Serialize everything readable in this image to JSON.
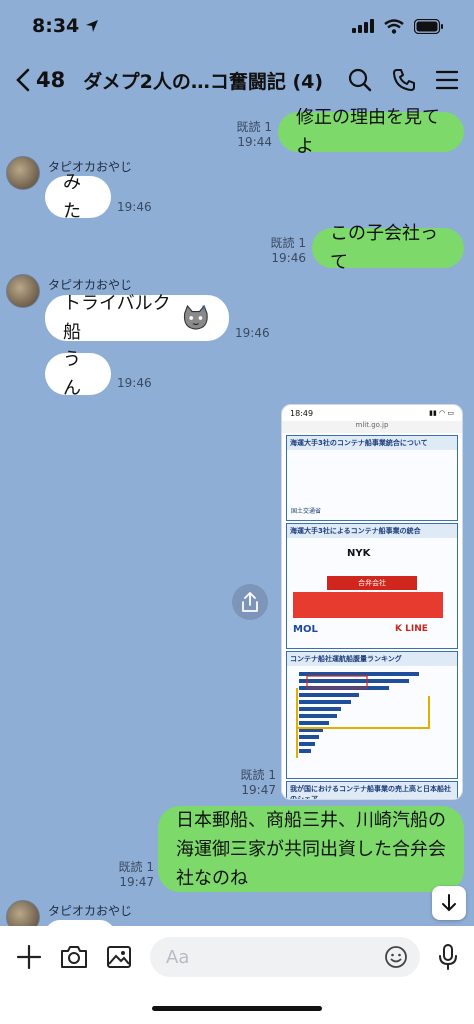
{
  "status": {
    "time": "8:34"
  },
  "header": {
    "back_count": "48",
    "title": "ダメプ2人の…コ奮闘記 (4)"
  },
  "messages": {
    "m1": {
      "text": "修正の理由を見てよ",
      "read": "既読 1",
      "time": "19:44"
    },
    "m2": {
      "sender": "タピオカおやじ",
      "text": "みた",
      "time": "19:46"
    },
    "m3": {
      "text": "この子会社って",
      "read": "既読 1",
      "time": "19:46"
    },
    "m4": {
      "sender": "タピオカおやじ",
      "text": "トライバルク船",
      "time": "19:46"
    },
    "m5": {
      "text": "うん",
      "time": "19:46"
    },
    "m6": {
      "read": "既読 1",
      "time": "19:47"
    },
    "m7": {
      "text": "日本郵船、商船三井、川崎汽船の海運御三家が共同出資した合弁会社なのね",
      "read": "既読 1",
      "time": "19:47"
    },
    "m8": {
      "sender": "タピオカおやじ"
    }
  },
  "image": {
    "time": "18:49",
    "url": "mlit.go.jp",
    "slide1_title": "海運大手3社のコンテナ船事業統合について",
    "slide1_org": "国土交通省",
    "slide2_title": "海運大手3社によるコンテナ船事業の統合",
    "nyk": "NYK",
    "jv": "合弁会社",
    "mol": "MOL",
    "kline": "K LINE",
    "slide3_title": "コンテナ船社運航船腹量ランキング",
    "slide4_title": "我が国におけるコンテナ船事業の売上高と日本船社のシェア"
  },
  "input": {
    "placeholder": "Aa"
  }
}
